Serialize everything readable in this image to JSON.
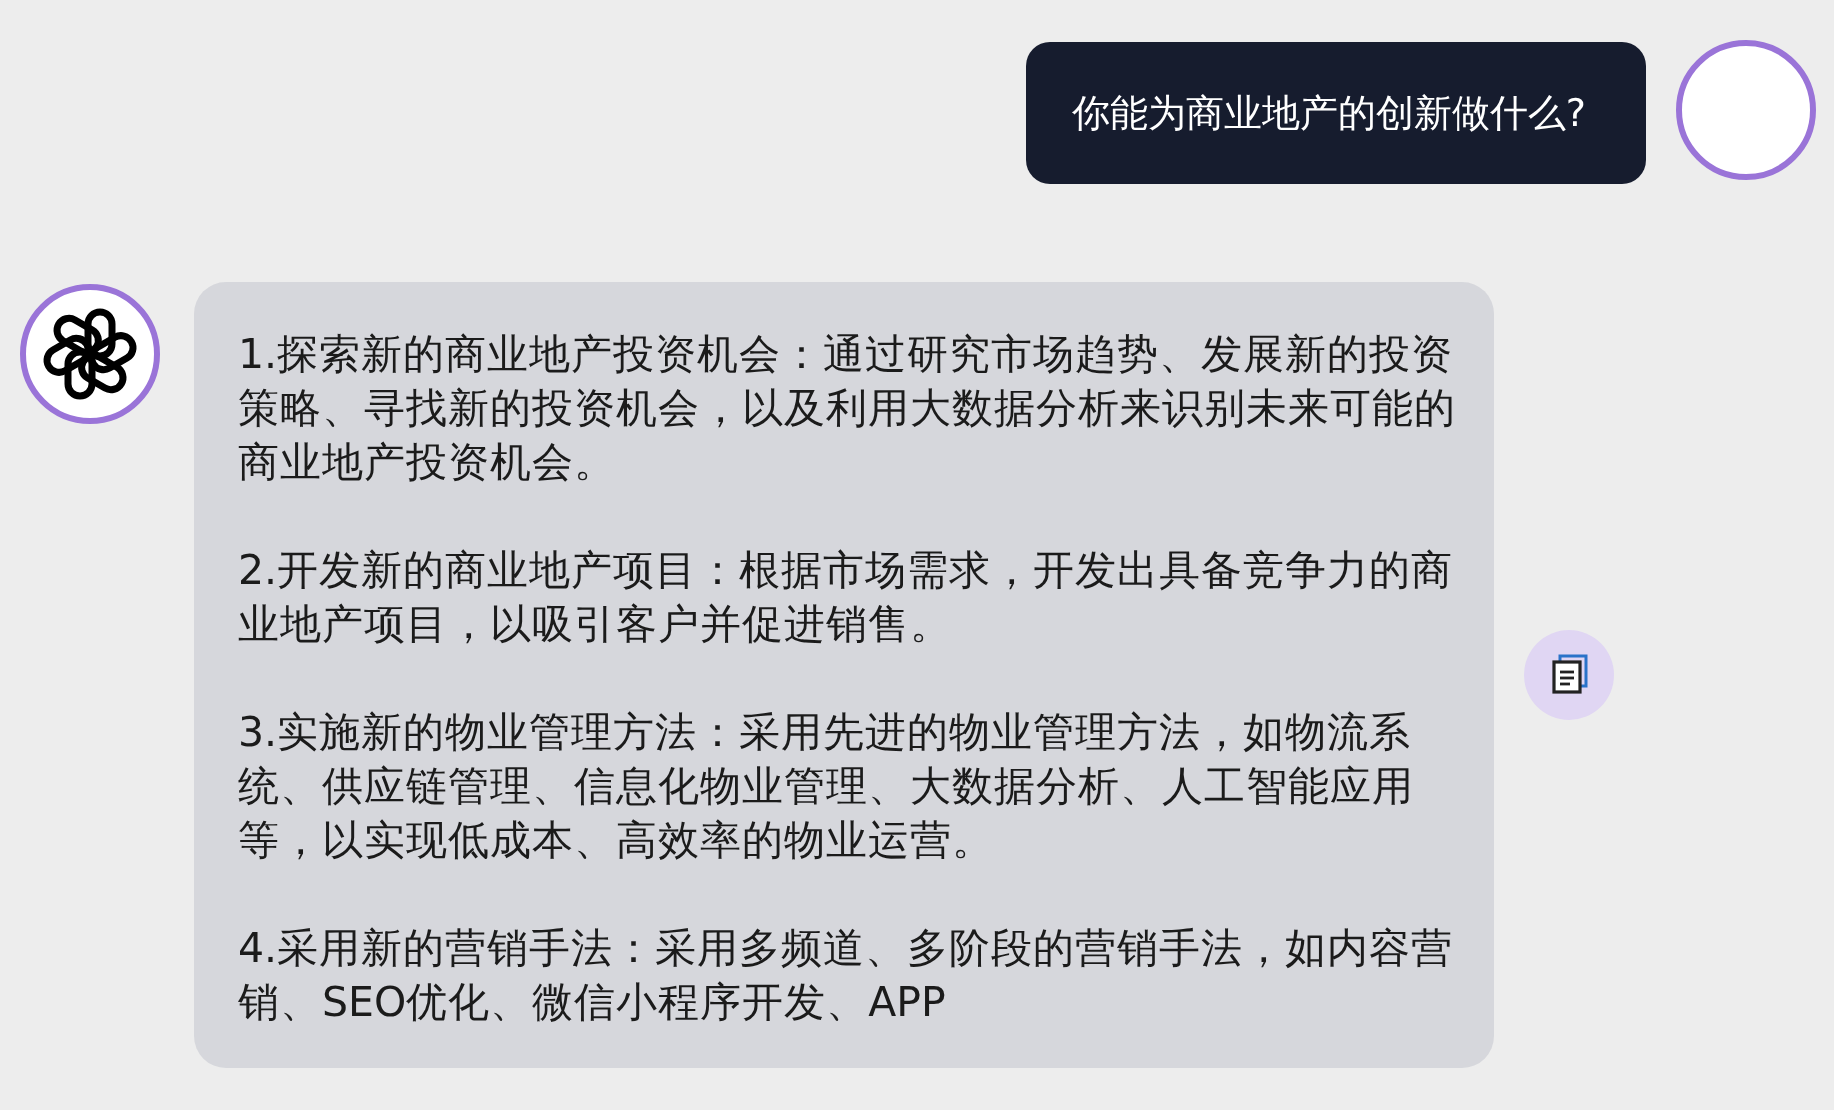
{
  "user_message": {
    "text": "你能为商业地产的创新做什么?"
  },
  "assistant_message": {
    "paragraphs": [
      "1.探索新的商业地产投资机会：通过研究市场趋势、发展新的投资策略、寻找新的投资机会，以及利用大数据分析来识别未来可能的商业地产投资机会。",
      "2.开发新的商业地产项目：根据市场需求，开发出具备竞争力的商业地产项目，以吸引客户并促进销售。",
      "3.实施新的物业管理方法：采用先进的物业管理方法，如物流系统、供应链管理、信息化物业管理、大数据分析、人工智能应用等，以实现低成本、高效率的物业运营。",
      "4.采用新的营销手法：采用多频道、多阶段的营销手法，如内容营销、SEO优化、微信小程序开发、APP"
    ]
  }
}
